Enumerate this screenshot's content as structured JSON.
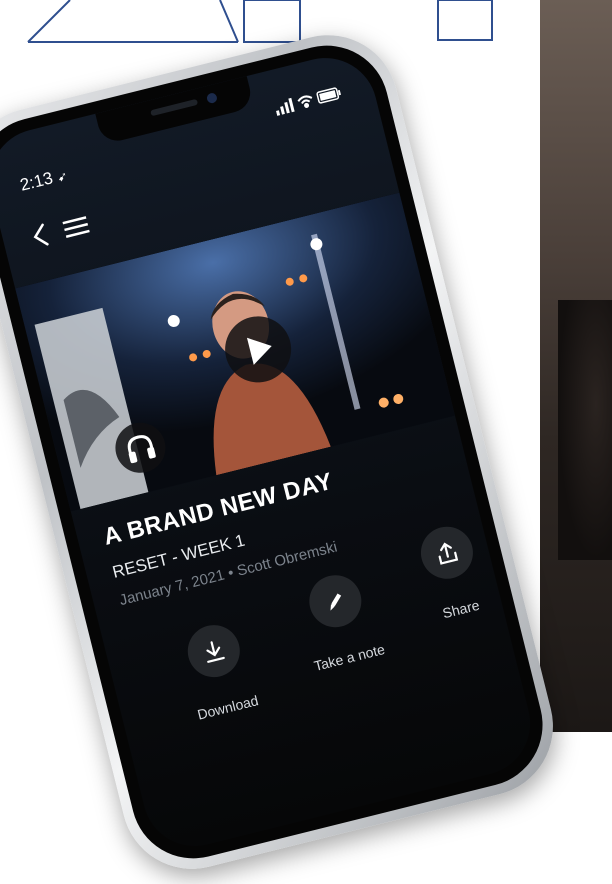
{
  "status_bar": {
    "time": "2:13"
  },
  "sermon": {
    "title": "A BRAND NEW DAY",
    "series": "RESET - WEEK 1",
    "meta": "January 7, 2021 • Scott Obremski"
  },
  "actions": {
    "download_label": "Download",
    "note_label": "Take a note",
    "share_label": "Share"
  },
  "icons": {
    "back": "chevron-left-icon",
    "menu": "hamburger-menu-icon",
    "play": "play-icon",
    "audio": "headphones-icon",
    "download": "download-icon",
    "note": "pencil-icon",
    "share": "share-icon"
  },
  "colors": {
    "screen_bg": "#0a0d12",
    "button_bg": "#24272b",
    "meta_text": "#7c838c"
  }
}
